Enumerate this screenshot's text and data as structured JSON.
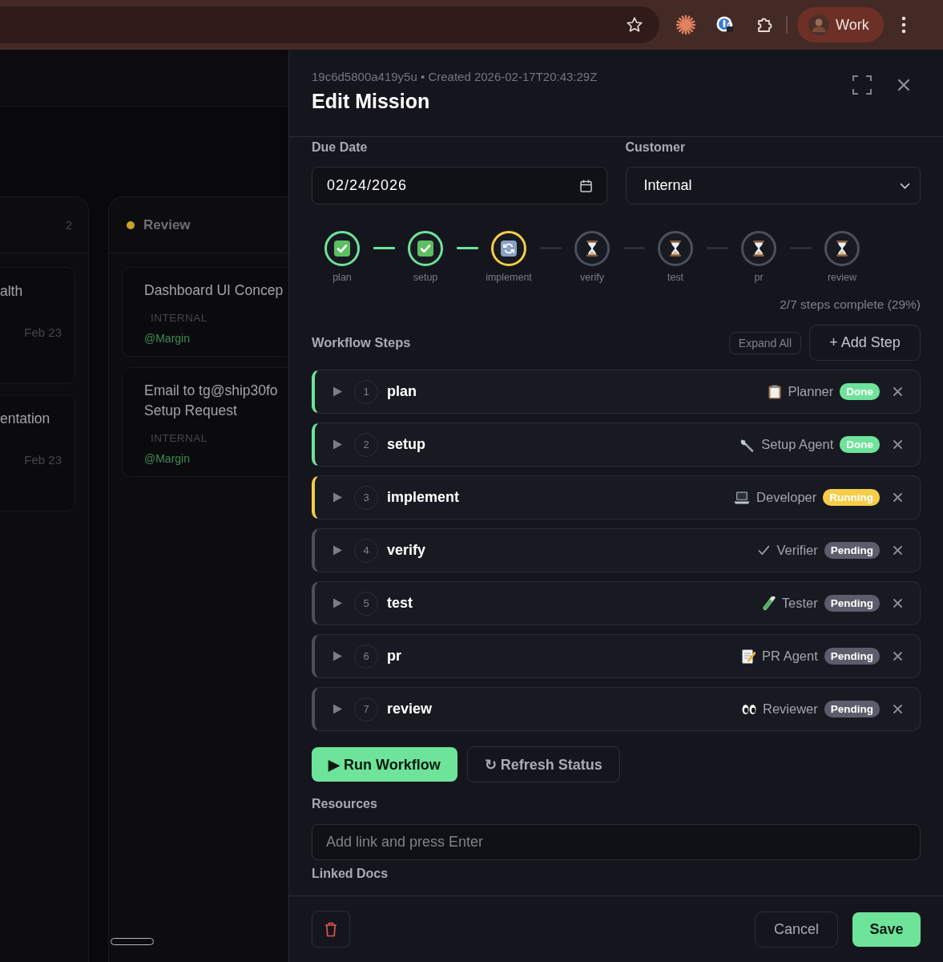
{
  "browser": {
    "profile": "Work"
  },
  "board": {
    "columns": [
      {
        "count": "2",
        "cards": [
          {
            "title_lines": [
              "alth"
            ],
            "date": "Feb 23"
          },
          {
            "title_lines": [
              "entation"
            ],
            "date": "Feb 23"
          }
        ]
      },
      {
        "title": "Review",
        "color": "#c9a227",
        "cards": [
          {
            "title_lines": [
              "Dashboard UI Concep"
            ],
            "customer": "INTERNAL",
            "assignee": "@Margin"
          },
          {
            "title_lines": [
              "Email to tg@ship30fo",
              "Setup Request"
            ],
            "customer": "INTERNAL",
            "assignee": "@Margin"
          }
        ]
      }
    ]
  },
  "drawer": {
    "meta": "19c6d5800a419y5u • Created 2026-02-17T20:43:29Z",
    "title": "Edit Mission",
    "due_date": {
      "label": "Due Date",
      "value": "02/24/2026"
    },
    "customer": {
      "label": "Customer",
      "value": "Internal"
    },
    "progress": {
      "nodes": [
        {
          "label": "plan",
          "kind": "done"
        },
        {
          "label": "setup",
          "kind": "done"
        },
        {
          "label": "implement",
          "kind": "running"
        },
        {
          "label": "verify",
          "kind": "pending"
        },
        {
          "label": "test",
          "kind": "pending"
        },
        {
          "label": "pr",
          "kind": "pending"
        },
        {
          "label": "review",
          "kind": "pending"
        }
      ],
      "summary": "2/7 steps complete (29%)"
    },
    "workflow": {
      "title": "Workflow Steps",
      "expand_all": "Expand All",
      "add_step": "+ Add Step",
      "steps": [
        {
          "number": "1",
          "name": "plan",
          "agent": "Planner",
          "status": "Done",
          "kind": "done"
        },
        {
          "number": "2",
          "name": "setup",
          "agent": "Setup Agent",
          "status": "Done",
          "kind": "done"
        },
        {
          "number": "3",
          "name": "implement",
          "agent": "Developer",
          "status": "Running",
          "kind": "running"
        },
        {
          "number": "4",
          "name": "verify",
          "agent": "Verifier",
          "status": "Pending",
          "kind": "pending"
        },
        {
          "number": "5",
          "name": "test",
          "agent": "Tester",
          "status": "Pending",
          "kind": "pending"
        },
        {
          "number": "6",
          "name": "pr",
          "agent": "PR Agent",
          "status": "Pending",
          "kind": "pending"
        },
        {
          "number": "7",
          "name": "review",
          "agent": "Reviewer",
          "status": "Pending",
          "kind": "pending"
        }
      ]
    },
    "actions": [
      {
        "kind": "run",
        "label": "▶ Run Workflow"
      },
      {
        "kind": "refresh",
        "label": "↻ Refresh Status"
      }
    ],
    "resources": {
      "label": "Resources",
      "placeholder": "Add link and press Enter"
    },
    "linked_docs": {
      "label": "Linked Docs"
    },
    "footer": {
      "cancel": "Cancel",
      "save": "Save"
    }
  }
}
